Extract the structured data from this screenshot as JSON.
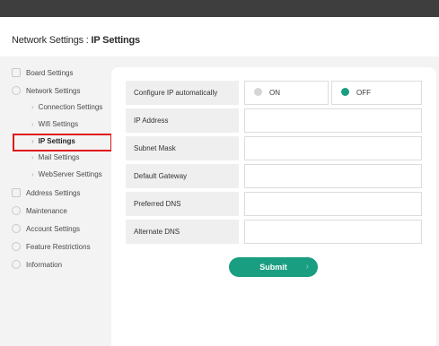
{
  "header": {
    "breadcrumb_parent": "Network Settings",
    "separator": " : ",
    "breadcrumb_current": "IP Settings"
  },
  "sidebar": {
    "items": [
      {
        "label": "Board Settings",
        "icon": "board-icon"
      },
      {
        "label": "Network Settings",
        "icon": "globe-icon"
      },
      {
        "label": "Address Settings",
        "icon": "address-book-icon"
      },
      {
        "label": "Maintenance",
        "icon": "gear-icon"
      },
      {
        "label": "Account Settings",
        "icon": "user-icon"
      },
      {
        "label": "Feature Restrictions",
        "icon": "prohibited-icon"
      },
      {
        "label": "Information",
        "icon": "info-icon"
      }
    ],
    "subitems": [
      {
        "label": "Connection Settings",
        "active": false
      },
      {
        "label": "Wifi Settings",
        "active": false
      },
      {
        "label": "IP Settings",
        "active": true
      },
      {
        "label": "Mail Settings",
        "active": false
      },
      {
        "label": "WebServer Settings",
        "active": false
      }
    ],
    "chevron": "›"
  },
  "form": {
    "configure_label": "Configure IP automatically",
    "on_label": "ON",
    "off_label": "OFF",
    "selected": "OFF",
    "fields": [
      {
        "label": "IP Address",
        "value": ""
      },
      {
        "label": "Subnet Mask",
        "value": ""
      },
      {
        "label": "Default Gateway",
        "value": ""
      },
      {
        "label": "Preferred DNS",
        "value": ""
      },
      {
        "label": "Alternate DNS",
        "value": ""
      }
    ],
    "submit_label": "Submit",
    "submit_arrow": "›"
  },
  "colors": {
    "accent": "#1a9e82",
    "highlight": "#e01818",
    "topbar": "#3e3e3e",
    "radio_off": "#d6d6d6"
  }
}
